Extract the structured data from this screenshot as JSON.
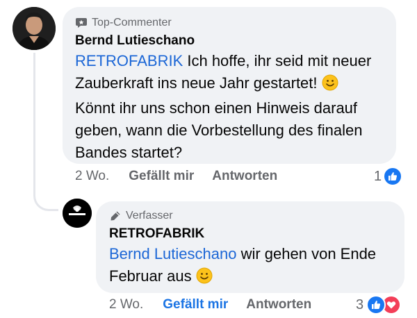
{
  "colors": {
    "mention": "#1b66d6",
    "liked_blue": "#1b74e4",
    "bubble": "#f0f2f5",
    "meta": "#65676b"
  },
  "comment": {
    "badge": "Top-Commenter",
    "badge_icon": "comment-badge-icon",
    "author": "Bernd Lutieschano",
    "mention": "RETROFABRIK",
    "line1": " Ich hoffe, ihr seid mit neuer",
    "line2": "Zauberkraft ins neue Jahr gestartet! ",
    "line3": "Könnt ihr uns schon einen Hinweis darauf",
    "line4": "geben, wann die Vorbestellung des finalen",
    "line5": "Bandes startet?",
    "time": "2 Wo.",
    "like_label": "Gefällt mir",
    "reply_label": "Antworten",
    "reaction_count": "1",
    "reactions": [
      "like-icon"
    ]
  },
  "reply": {
    "badge": "Verfasser",
    "badge_icon": "pen-icon",
    "author": "RETROFABRIK",
    "mention": "Bernd Lutieschano",
    "line1": " wir gehen von Ende",
    "line2": "Februar aus ",
    "time": "2 Wo.",
    "like_label": "Gefällt mir",
    "liked": true,
    "reply_label": "Antworten",
    "reaction_count": "3",
    "reactions": [
      "like-icon",
      "love-icon"
    ]
  }
}
